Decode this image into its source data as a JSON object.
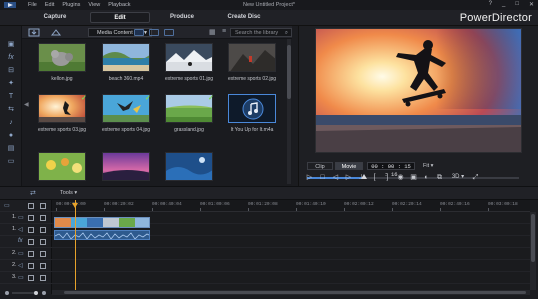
{
  "titlebar": {
    "menus": [
      "File",
      "Edit",
      "Plugins",
      "View",
      "Playback"
    ],
    "doc_title": "New Untitled Project*",
    "controls": [
      "?",
      "_",
      "□",
      "✕"
    ]
  },
  "modes": {
    "tabs": [
      "Capture",
      "Edit",
      "Produce",
      "Create Disc"
    ],
    "active": "Edit",
    "brand": "PowerDirector"
  },
  "library": {
    "dropdown": "Media Content",
    "search_placeholder": "Search the library",
    "items": [
      {
        "label": "kellon.jpg",
        "checked": false,
        "thumb": "kitten"
      },
      {
        "label": "beach 360.mp4",
        "checked": false,
        "thumb": "beach"
      },
      {
        "label": "extreme sports 01.jpg",
        "checked": false,
        "thumb": "skydive"
      },
      {
        "label": "extreme sports 02.jpg",
        "checked": false,
        "thumb": "mountain"
      },
      {
        "label": "extreme sports 03.jpg",
        "checked": true,
        "thumb": "skate"
      },
      {
        "label": "extreme sports 04.jpg",
        "checked": true,
        "thumb": "skydive2"
      },
      {
        "label": "grassland.jpg",
        "checked": true,
        "thumb": "grass"
      },
      {
        "label": "It You Up for It.m4a",
        "checked": false,
        "thumb": "music"
      },
      {
        "label": "",
        "checked": false,
        "thumb": "flowers"
      },
      {
        "label": "",
        "checked": false,
        "thumb": "purple"
      },
      {
        "label": "",
        "checked": false,
        "thumb": "blue"
      }
    ]
  },
  "preview": {
    "clip_label": "Clip",
    "movie_label": "Movie",
    "timecode": "00 : 00 : 15 : 16",
    "fit_label": "Fit",
    "threed_label": "3D",
    "progress": 0.27
  },
  "timeline": {
    "tools_label": "Tools",
    "ruler_labels": [
      "00:00:00:00",
      "00:00:20:02",
      "00:00:40:04",
      "00:01:00:06",
      "00:01:20:08",
      "00:01:40:10",
      "00:02:00:12",
      "00:02:20:14",
      "00:02:40:16",
      "00:03:00:18"
    ],
    "tracks": [
      "1.",
      "1.",
      "",
      "2.",
      "2.",
      "3."
    ]
  },
  "colors": {
    "accent": "#4a88d9",
    "playhead": "#e6a22b",
    "check": "#7ed957"
  }
}
